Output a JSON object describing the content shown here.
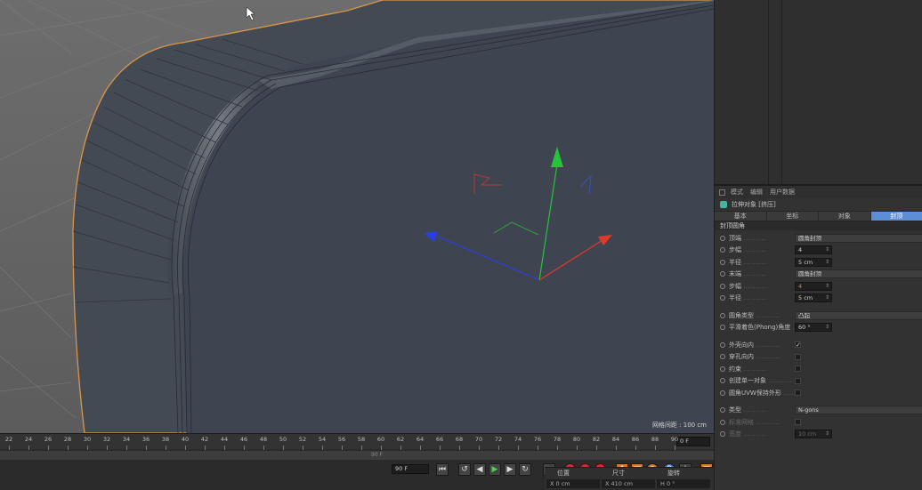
{
  "viewport": {
    "grid_spacing_label": "网格间距 : 100 cm"
  },
  "attributes": {
    "menu": [
      "模式",
      "编辑",
      "用户数据"
    ],
    "object_title": "拉伸对象 [挤压]",
    "tabs": [
      "基本",
      "坐标",
      "对象",
      "封顶"
    ],
    "active_tab": "封顶",
    "section": "封顶圆角",
    "start_cap": {
      "label": "顶端",
      "value": "圆角封顶",
      "steps_label": "步幅",
      "steps_value": "4",
      "radius_label": "半径",
      "radius_value": "5 cm"
    },
    "end_cap": {
      "label": "末端",
      "value": "圆角封顶",
      "steps_label": "步幅",
      "steps_value": "4",
      "radius_label": "半径",
      "radius_value": "5 cm"
    },
    "fillet_type_label": "圆角类型",
    "fillet_type_value": "凸起",
    "phong_label": "平滑着色(Phong)角度",
    "phong_value": "60 °",
    "outer_inward_label": "外壳向内",
    "hole_inward_label": "穿孔向内",
    "constrain_label": "约束",
    "single_object_label": "创建单一对象",
    "uvw_label": "圆角UVW保持外形",
    "type_label": "类型",
    "type_value": "N-gons",
    "standard_grid_label": "标准网格",
    "width_label": "宽度",
    "width_value": "10 cm"
  },
  "timeline": {
    "ticks": [
      "22",
      "24",
      "26",
      "28",
      "30",
      "32",
      "34",
      "36",
      "38",
      "40",
      "42",
      "44",
      "46",
      "48",
      "50",
      "52",
      "54",
      "56",
      "58",
      "60",
      "62",
      "64",
      "66",
      "68",
      "70",
      "72",
      "74",
      "76",
      "78",
      "80",
      "82",
      "84",
      "86",
      "88",
      "90"
    ],
    "current_frame": "0 F",
    "range_end_label": "90 F",
    "end_frame_field": "90 F"
  },
  "coordinates": {
    "heads": [
      "位置",
      "尺寸",
      "旋转"
    ],
    "values": [
      "X  0 cm",
      "X  410 cm",
      "H  0 °"
    ]
  },
  "colors": {
    "viewport_bg": "#6b6b6b",
    "object_fill": "#414853",
    "selection_outline": "#d9964a",
    "axis_x": "#e0392b",
    "axis_y": "#26c33a",
    "axis_z": "#2b3fe0",
    "active_tab": "#5b8ed6"
  }
}
